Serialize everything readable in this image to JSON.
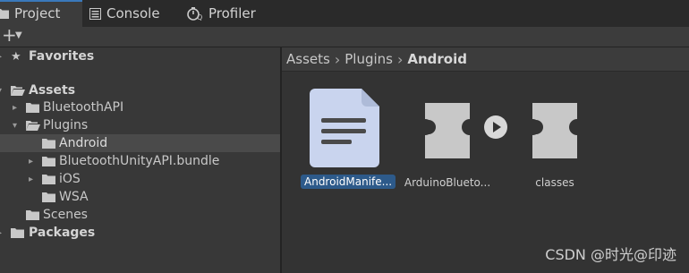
{
  "tabs": [
    {
      "label": "Project",
      "icon": "folder-icon"
    },
    {
      "label": "Console",
      "icon": "console-icon"
    },
    {
      "label": "Profiler",
      "icon": "profiler-icon"
    }
  ],
  "tree": {
    "favorites": "Favorites",
    "assets": "Assets",
    "bluetoothapi": "BluetoothAPI",
    "plugins": "Plugins",
    "android": "Android",
    "bundle": "BluetoothUnityAPI.bundle",
    "ios": "iOS",
    "wsa": "WSA",
    "scenes": "Scenes",
    "packages": "Packages"
  },
  "breadcrumb": [
    "Assets",
    "Plugins",
    "Android"
  ],
  "items": [
    {
      "label": "AndroidManife...",
      "icon": "document-icon",
      "selected": true
    },
    {
      "label": "ArduinoBlueto...",
      "icon": "plugin-icon",
      "selected": false
    },
    {
      "label": "classes",
      "icon": "plugin-icon",
      "selected": false
    }
  ],
  "watermark": "CSDN @时光@印迹"
}
